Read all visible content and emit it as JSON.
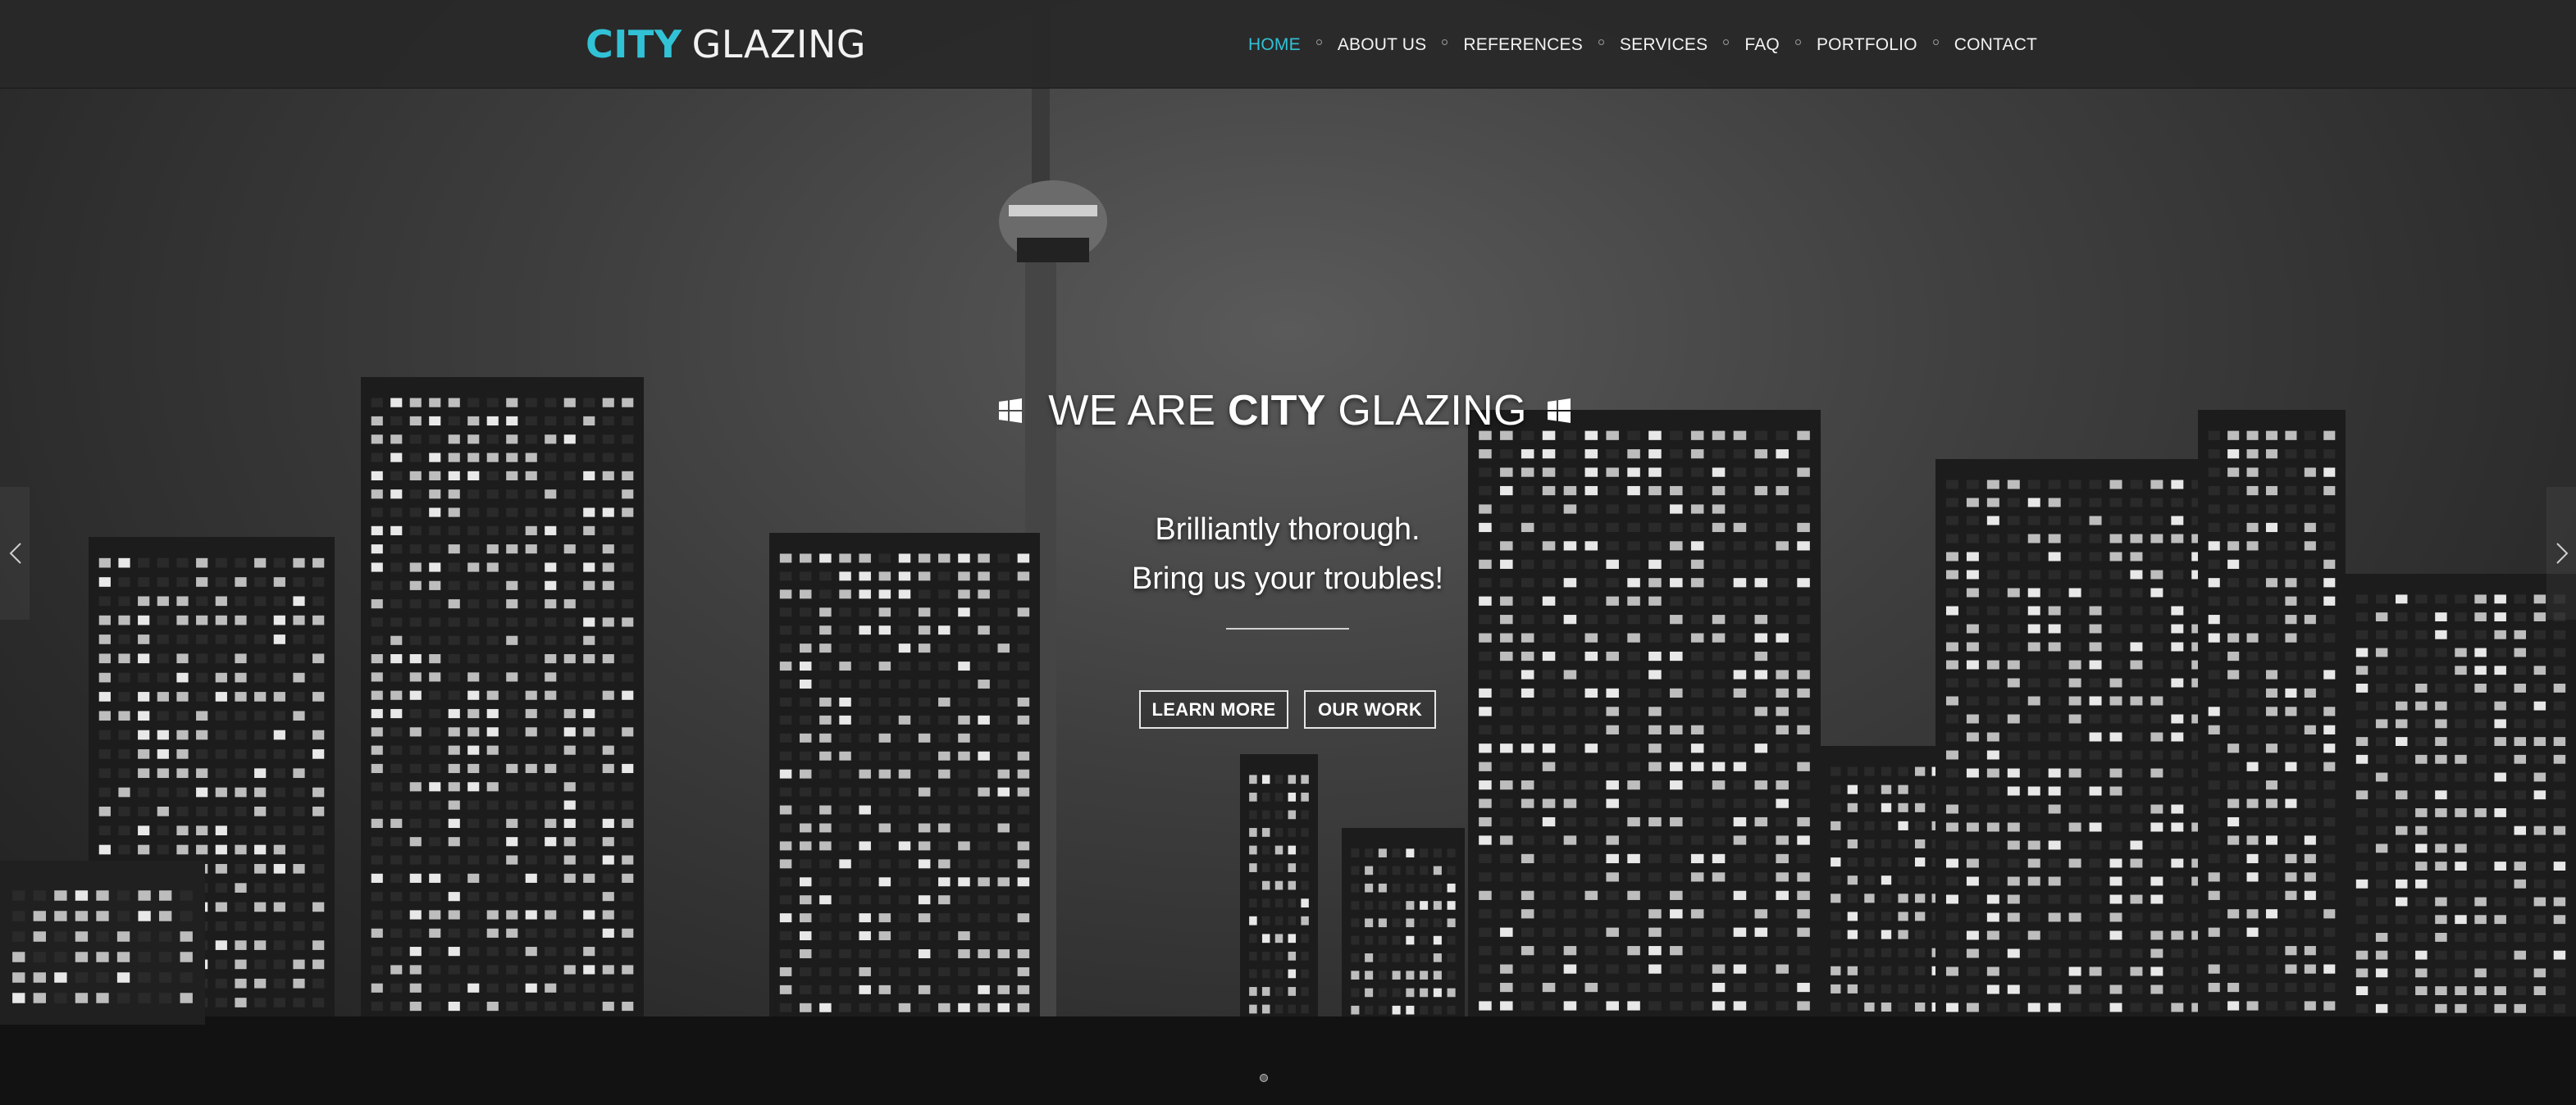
{
  "brand": {
    "name_bold": "CITY",
    "name_light": "GLAZING",
    "accent_color": "#32c2d6"
  },
  "nav": {
    "items": [
      {
        "label": "HOME",
        "active": true
      },
      {
        "label": "ABOUT US",
        "active": false
      },
      {
        "label": "REFERENCES",
        "active": false
      },
      {
        "label": "SERVICES",
        "active": false
      },
      {
        "label": "FAQ",
        "active": false
      },
      {
        "label": "PORTFOLIO",
        "active": false
      },
      {
        "label": "CONTACT",
        "active": false
      }
    ]
  },
  "hero": {
    "headline_prefix": "WE ARE",
    "headline_bold": "CITY",
    "headline_suffix": "GLAZING",
    "headline_icon": "windows-logo-icon",
    "tagline_line1": "Brilliantly thorough.",
    "tagline_line2": "Bring us your troubles!",
    "buttons": {
      "learn_more": "LEARN MORE",
      "our_work": "OUR WORK"
    },
    "prev_icon": "chevron-left-icon",
    "next_icon": "chevron-right-icon",
    "background": "black-and-white night city skyline with tall tower"
  }
}
